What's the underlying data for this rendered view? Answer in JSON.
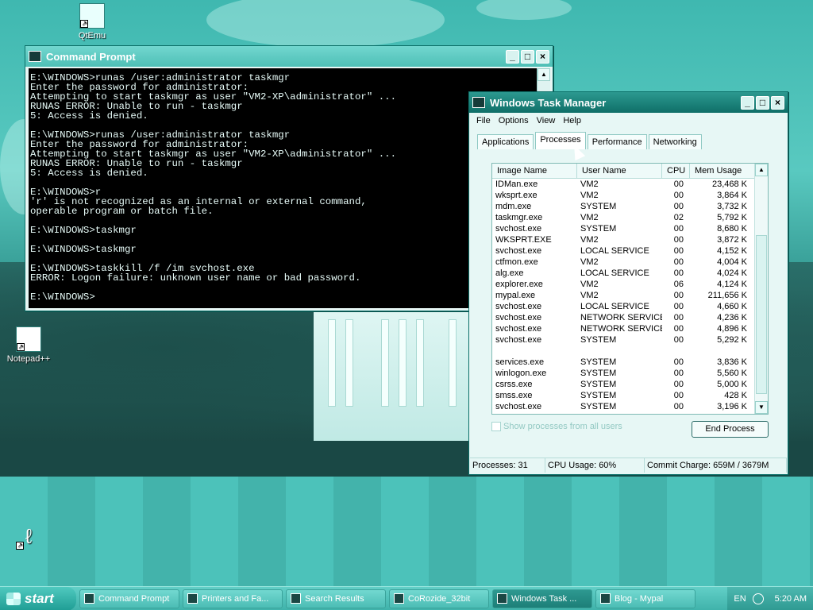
{
  "desktop": {
    "icons": [
      {
        "label": "QtEmu"
      },
      {
        "label": "Notepad++"
      },
      {
        "label": ""
      }
    ]
  },
  "cmd": {
    "title": "Command Prompt",
    "lines": [
      "E:\\WINDOWS>runas /user:administrator taskmgr",
      "Enter the password for administrator:",
      "Attempting to start taskmgr as user \"VM2-XP\\administrator\" ...",
      "RUNAS ERROR: Unable to run - taskmgr",
      "5: Access is denied.",
      "",
      "E:\\WINDOWS>runas /user:administrator taskmgr",
      "Enter the password for administrator:",
      "Attempting to start taskmgr as user \"VM2-XP\\administrator\" ...",
      "RUNAS ERROR: Unable to run - taskmgr",
      "5: Access is denied.",
      "",
      "E:\\WINDOWS>r",
      "'r' is not recognized as an internal or external command,",
      "operable program or batch file.",
      "",
      "E:\\WINDOWS>taskmgr",
      "",
      "E:\\WINDOWS>taskmgr",
      "",
      "E:\\WINDOWS>taskkill /f /im svchost.exe",
      "ERROR: Logon failure: unknown user name or bad password.",
      "",
      "E:\\WINDOWS>"
    ]
  },
  "taskmgr": {
    "title": "Windows Task Manager",
    "menu": [
      "File",
      "Options",
      "View",
      "Help"
    ],
    "tabs": [
      "Applications",
      "Processes",
      "Performance",
      "Networking"
    ],
    "active_tab": "Processes",
    "columns": [
      "Image Name",
      "User Name",
      "CPU",
      "Mem Usage"
    ],
    "processes": [
      [
        "IDMan.exe",
        "VM2",
        "00",
        "23,468 K"
      ],
      [
        "wksprt.exe",
        "VM2",
        "00",
        "3,864 K"
      ],
      [
        "mdm.exe",
        "SYSTEM",
        "00",
        "3,732 K"
      ],
      [
        "taskmgr.exe",
        "VM2",
        "02",
        "5,792 K"
      ],
      [
        "svchost.exe",
        "SYSTEM",
        "00",
        "8,680 K"
      ],
      [
        "WKSPRT.EXE",
        "VM2",
        "00",
        "3,872 K"
      ],
      [
        "svchost.exe",
        "LOCAL SERVICE",
        "00",
        "4,152 K"
      ],
      [
        "ctfmon.exe",
        "VM2",
        "00",
        "4,004 K"
      ],
      [
        "alg.exe",
        "LOCAL SERVICE",
        "00",
        "4,024 K"
      ],
      [
        "explorer.exe",
        "VM2",
        "06",
        "4,124 K"
      ],
      [
        "mypal.exe",
        "VM2",
        "00",
        "211,656 K"
      ],
      [
        "svchost.exe",
        "LOCAL SERVICE",
        "00",
        "4,660 K"
      ],
      [
        "svchost.exe",
        "NETWORK SERVICE",
        "00",
        "4,236 K"
      ],
      [
        "svchost.exe",
        "NETWORK SERVICE",
        "00",
        "4,896 K"
      ],
      [
        "svchost.exe",
        "SYSTEM",
        "00",
        "5,292 K"
      ],
      [
        "",
        "",
        "",
        ""
      ],
      [
        "services.exe",
        "SYSTEM",
        "00",
        "3,836 K"
      ],
      [
        "winlogon.exe",
        "SYSTEM",
        "00",
        "5,560 K"
      ],
      [
        "csrss.exe",
        "SYSTEM",
        "00",
        "5,000 K"
      ],
      [
        "smss.exe",
        "SYSTEM",
        "00",
        "428 K"
      ],
      [
        "svchost.exe",
        "SYSTEM",
        "00",
        "3,196 K"
      ]
    ],
    "show_all_label": "Show processes from all users",
    "end_process_label": "End Process",
    "status": {
      "processes": "Processes: 31",
      "cpu": "CPU Usage: 60%",
      "commit": "Commit Charge: 659M / 3679M"
    }
  },
  "taskbar": {
    "start_label": "start",
    "tasks": [
      {
        "label": "Command Prompt",
        "active": false
      },
      {
        "label": "Printers and Fa...",
        "active": false
      },
      {
        "label": "Search Results",
        "active": false
      },
      {
        "label": "CoRozide_32bit",
        "active": false
      },
      {
        "label": "Windows Task ...",
        "active": true
      },
      {
        "label": "Blog - Mypal",
        "active": false
      }
    ],
    "lang": "EN",
    "clock": "5:20 AM"
  }
}
